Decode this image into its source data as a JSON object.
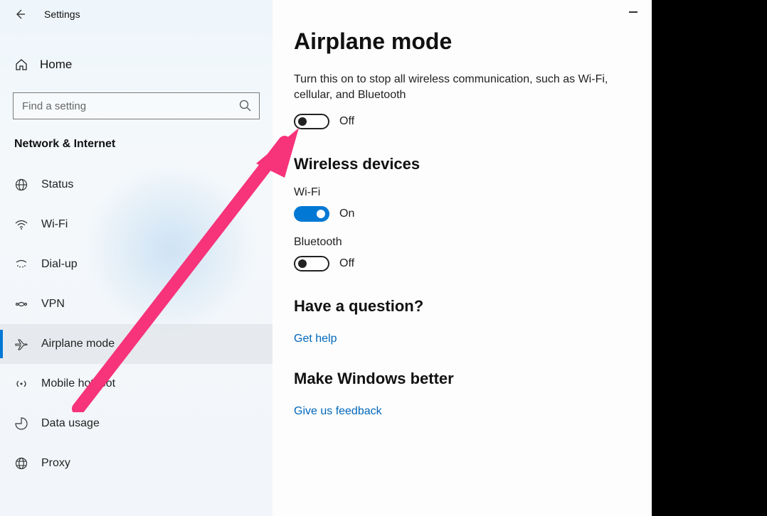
{
  "titlebar": {
    "app_title": "Settings"
  },
  "sidebar": {
    "home_label": "Home",
    "search_placeholder": "Find a setting",
    "category": "Network & Internet",
    "items": [
      {
        "label": "Status"
      },
      {
        "label": "Wi-Fi"
      },
      {
        "label": "Dial-up"
      },
      {
        "label": "VPN"
      },
      {
        "label": "Airplane mode"
      },
      {
        "label": "Mobile hotspot"
      },
      {
        "label": "Data usage"
      },
      {
        "label": "Proxy"
      }
    ]
  },
  "page": {
    "title": "Airplane mode",
    "description": "Turn this on to stop all wireless communication, such as Wi-Fi, cellular, and Bluetooth",
    "airplane_toggle_state": "Off",
    "section_wireless": "Wireless devices",
    "wifi": {
      "label": "Wi-Fi",
      "state": "On"
    },
    "bluetooth": {
      "label": "Bluetooth",
      "state": "Off"
    },
    "question_heading": "Have a question?",
    "get_help_link": "Get help",
    "better_heading": "Make Windows better",
    "feedback_link": "Give us feedback"
  },
  "annotation": {
    "arrow_color": "#f7337a"
  }
}
